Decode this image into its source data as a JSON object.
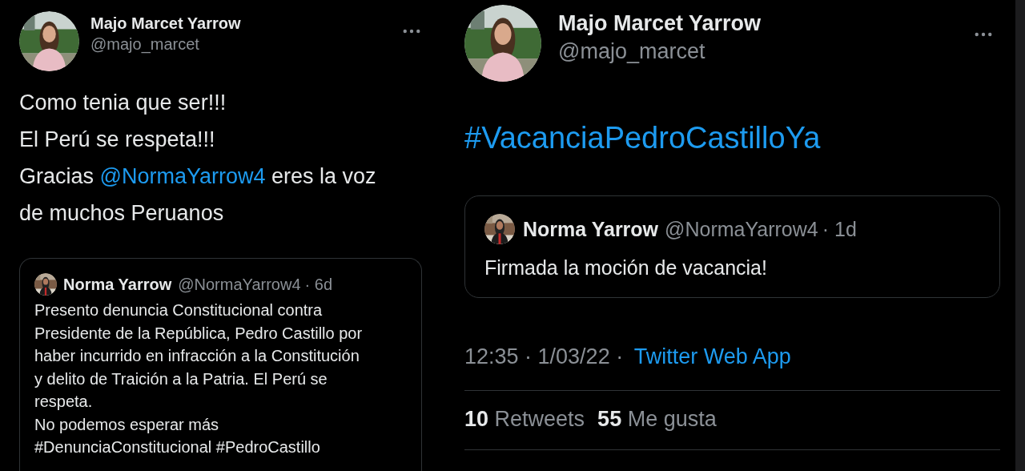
{
  "tweets": [
    {
      "author": {
        "name": "Majo Marcet Yarrow",
        "handle": "@majo_marcet"
      },
      "body": [
        [
          {
            "kind": "text",
            "text": "Como tenia que ser!!!"
          }
        ],
        [
          {
            "kind": "text",
            "text": "El Perú se respeta!!!"
          }
        ],
        [
          {
            "kind": "text",
            "text": "Gracias "
          },
          {
            "kind": "link",
            "text": "@NormaYarrow4"
          },
          {
            "kind": "text",
            "text": " eres la voz"
          }
        ],
        [
          {
            "kind": "text",
            "text": "de muchos Peruanos"
          }
        ]
      ],
      "quote": {
        "name": "Norma Yarrow",
        "handle": "@NormaYarrow4",
        "time": "· 6d",
        "paragraphs": [
          [
            "Presento denuncia Constitucional contra",
            "Presidente de la República, Pedro Castillo por",
            "haber incurrido en infracción a la Constitución",
            "y delito de Traición a la Patria. El Perú se",
            "respeta."
          ],
          [
            "No podemos esperar más"
          ],
          [
            "#DenunciaConstitucional #PedroCastillo"
          ]
        ]
      }
    },
    {
      "author": {
        "name": "Majo Marcet Yarrow",
        "handle": "@majo_marcet"
      },
      "body": [
        [
          {
            "kind": "link",
            "text": "#VacanciaPedroCastilloYa"
          }
        ]
      ],
      "quote": {
        "name": "Norma Yarrow",
        "handle": "@NormaYarrow4",
        "time": "· 1d",
        "paragraphs": [
          [
            "Firmada la moción de vacancia!"
          ]
        ]
      },
      "meta": {
        "timestamp": "12:35 · 1/03/22 ·",
        "source": "Twitter Web App"
      },
      "stats": [
        {
          "count": "10",
          "label": "Retweets"
        },
        {
          "count": "55",
          "label": "Me gusta"
        }
      ]
    }
  ]
}
